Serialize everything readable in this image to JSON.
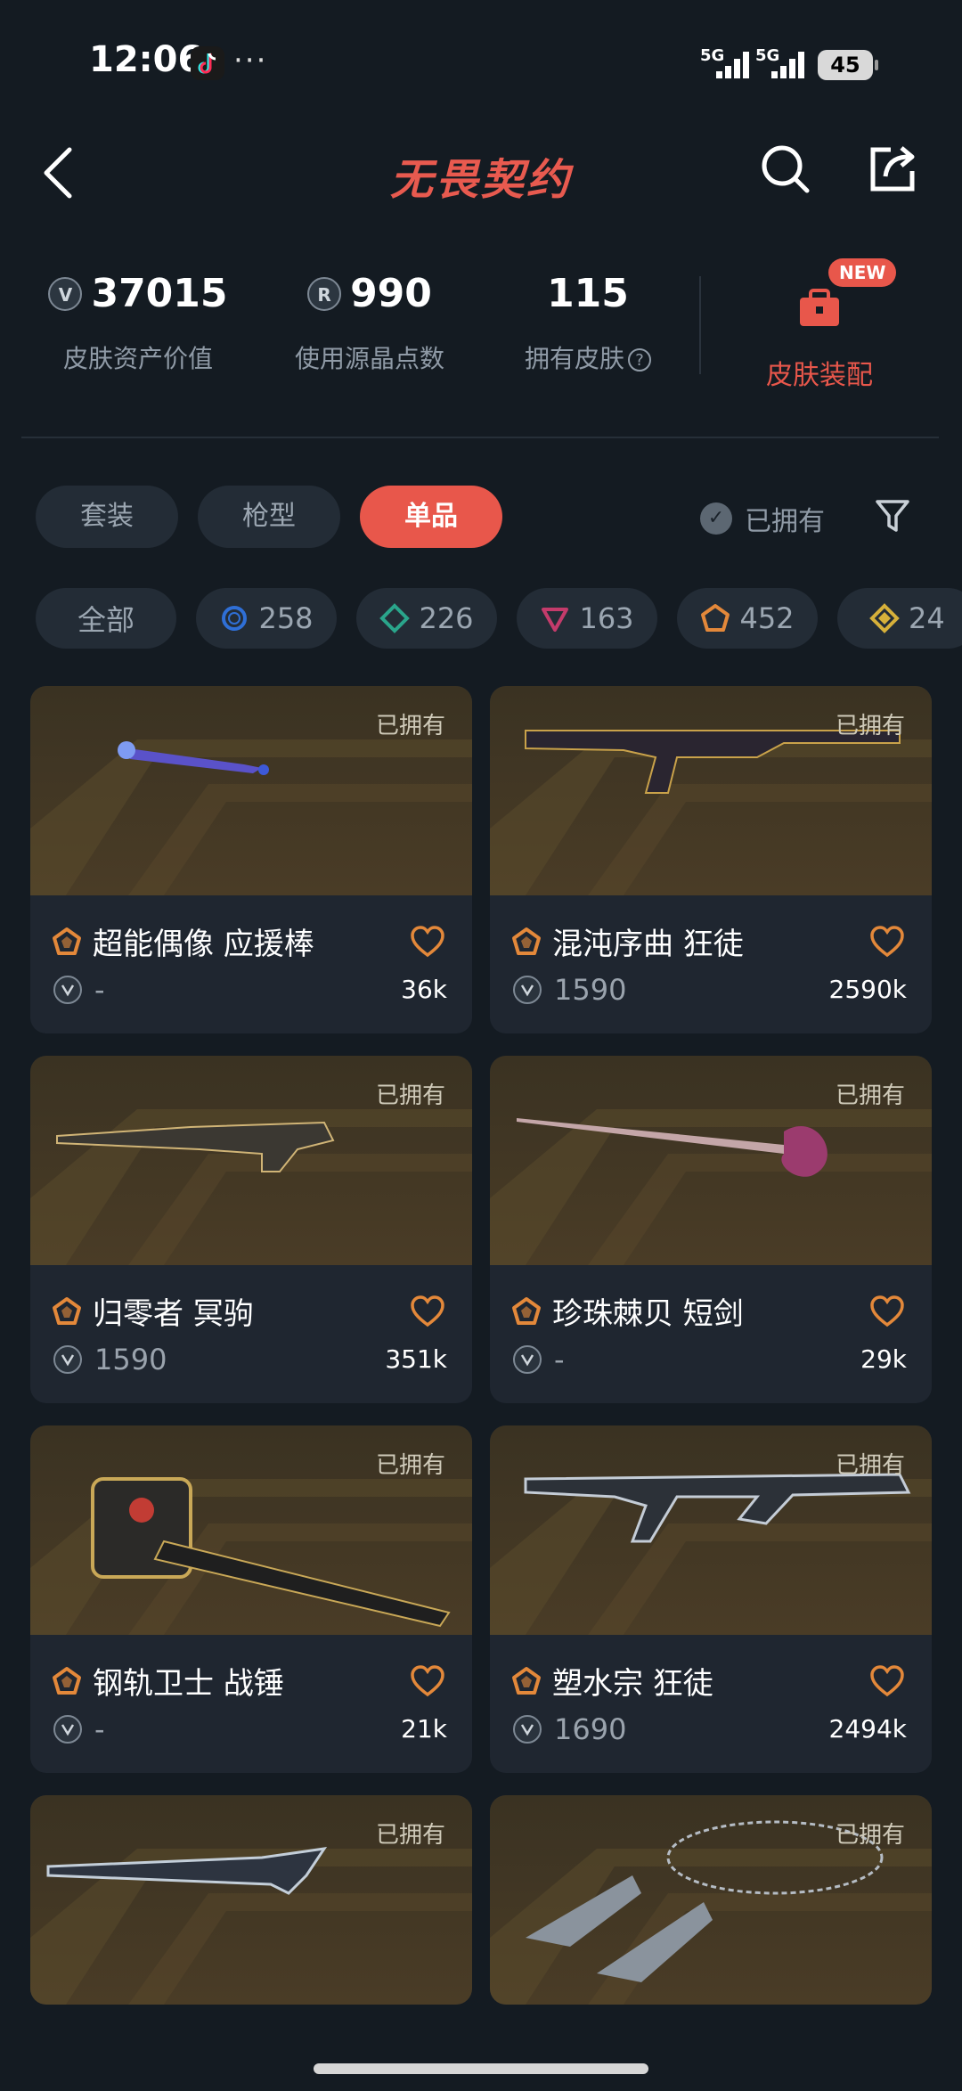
{
  "status": {
    "time": "12:06",
    "dots": "···",
    "sig1": "5G",
    "sig2": "5G",
    "battery": "45"
  },
  "header": {
    "title": "无畏契约"
  },
  "stats": {
    "asset_value": "37015",
    "asset_label": "皮肤资产价值",
    "points": "990",
    "points_label": "使用源晶点数",
    "skins_owned": "115",
    "skins_label": "拥有皮肤",
    "equip_label": "皮肤装配",
    "new_badge": "NEW"
  },
  "tabs": [
    "套装",
    "枪型",
    "单品"
  ],
  "owned_filter": "已拥有",
  "chips": [
    {
      "label": "全部"
    },
    {
      "label": "258",
      "color": "#2f6fd6"
    },
    {
      "label": "226",
      "color": "#2aa58b"
    },
    {
      "label": "163",
      "color": "#c43b6b"
    },
    {
      "label": "452",
      "color": "#e3883a"
    },
    {
      "label": "24",
      "color": "#d6b03a"
    }
  ],
  "cards": [
    {
      "owned": "已拥有",
      "name": "超能偶像 应援棒",
      "price": "-",
      "likes": "36k"
    },
    {
      "owned": "已拥有",
      "name": "混沌序曲 狂徒",
      "price": "1590",
      "likes": "2590k"
    },
    {
      "owned": "已拥有",
      "name": "归零者 冥驹",
      "price": "1590",
      "likes": "351k"
    },
    {
      "owned": "已拥有",
      "name": "珍珠棘贝 短剑",
      "price": "-",
      "likes": "29k"
    },
    {
      "owned": "已拥有",
      "name": "钢轨卫士 战锤",
      "price": "-",
      "likes": "21k"
    },
    {
      "owned": "已拥有",
      "name": "塑水宗 狂徒",
      "price": "1690",
      "likes": "2494k"
    },
    {
      "owned": "已拥有",
      "name": "",
      "price": "",
      "likes": ""
    },
    {
      "owned": "已拥有",
      "name": "",
      "price": "",
      "likes": ""
    }
  ],
  "colors": {
    "accent": "#e8574b",
    "rarity_exclusive": "#e3883a"
  }
}
